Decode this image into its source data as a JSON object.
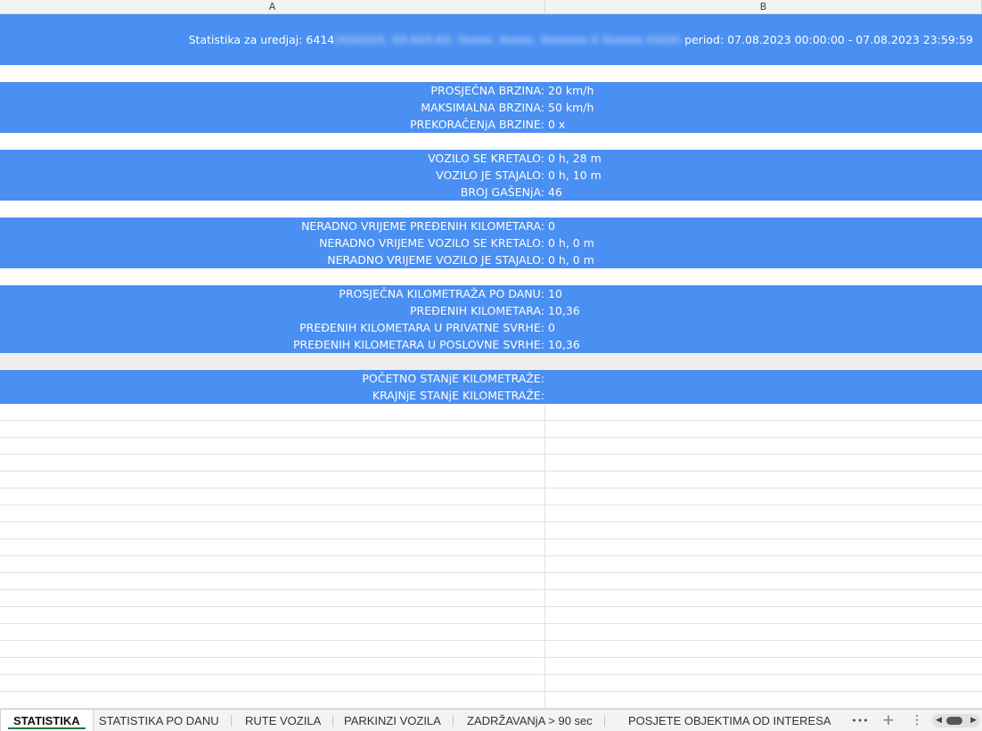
{
  "columns": [
    "A",
    "B"
  ],
  "header": {
    "prefix": "Statistika za uredjaj: 6414",
    "redacted": "(XXXXXX, XX-XXX-XX, Xxxxx, Xxxxx, Xxxxxxx X Xxxxxx XXXX)",
    "period": " period: 07.08.2023 00:00:00 - 07.08.2023 23:59:59"
  },
  "speed": {
    "avg_label": "PROSJEČNA BRZINA:",
    "avg_value": "20 km/h",
    "max_label": "MAKSIMALNA BRZINA:",
    "max_value": "50 km/h",
    "over_label": "PREKORAČENjA BRZINE:",
    "over_value": "0 x"
  },
  "motion": {
    "moving_label": "VOZILO SE KRETALO:",
    "moving_value": "0 h, 28 m",
    "stopped_label": "VOZILO JE STAJALO:",
    "stopped_value": "0 h, 10 m",
    "shutdowns_label": "BROJ GAŠENjA:",
    "shutdowns_value": "46"
  },
  "offhours": {
    "km_label": "NERADNO VRIJEME PREĐENIH KILOMETARA:",
    "km_value": "0",
    "moving_label": "NERADNO VRIJEME VOZILO SE KRETALO:",
    "moving_value": "0 h, 0 m",
    "stopped_label": "NERADNO VRIJEME VOZILO JE STAJALO:",
    "stopped_value": "0 h, 0 m"
  },
  "mileage": {
    "avg_label": "PROSJEČNA KILOMETRAŽA PO DANU:",
    "avg_value": "10",
    "total_label": "PREĐENIH KILOMETARA:",
    "total_value": "10,36",
    "private_label": "PREĐENIH KILOMETARA U PRIVATNE SVRHE:",
    "private_value": "0",
    "business_label": "PREĐENIH KILOMETARA U POSLOVNE SVRHE:",
    "business_value": "10,36"
  },
  "odometer": {
    "start_label": "POČETNO STANjE KILOMETRAŽE:",
    "end_label": "KRAJNjE STANjE KILOMETRAŽE:"
  },
  "tabs": [
    "STATISTIKA",
    "STATISTIKA PO DANU",
    "RUTE VOZILA",
    "PARKINZI VOZILA",
    "ZADRŽAVANjA > 90 sec",
    "POSJETE OBJEKTIMA OD INTERESA"
  ],
  "controls": {
    "more": "•••",
    "add": "+",
    "menu": "⋮"
  },
  "colors": {
    "band": "#4a8ff2",
    "active_tab_underline": "#1e7a3e"
  }
}
